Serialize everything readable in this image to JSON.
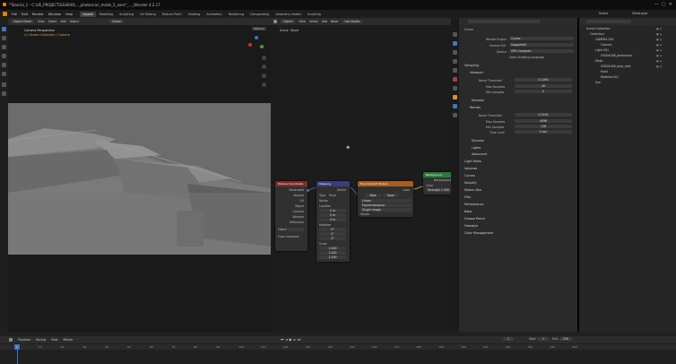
{
  "window": {
    "title": "*Tutorial_1 - C:\\UE_PROJECT\\GS4040\\..._photoscan_mode_5_aero*_..._Blender 4.2.17"
  },
  "menu": {
    "items": [
      "File",
      "Edit",
      "Render",
      "Window",
      "Help"
    ]
  },
  "workspaces": [
    "Layout",
    "Modeling",
    "Sculpting",
    "UV Editing",
    "Texture Paint",
    "Shading",
    "Animation",
    "Rendering",
    "Compositing",
    "Geometry Nodes",
    "Scripting"
  ],
  "active_workspace": "Layout",
  "topright": {
    "scene": "Scene",
    "view_layer": "ViewLayer"
  },
  "viewport": {
    "header": {
      "mode": "Object Mode",
      "view": "View",
      "select": "Select",
      "add": "Add",
      "object": "Object",
      "global": "Global"
    },
    "camera_label": "Camera Perspective",
    "collection_label": "(1) Scene Collection | Camera",
    "options": "Options"
  },
  "node_editor": {
    "header": {
      "type": "Object",
      "view": "View",
      "select": "Select",
      "add": "Add",
      "node": "Node",
      "use_nodes": "Use Nodes"
    },
    "breadcrumb": "Scene",
    "world": "World",
    "nodes": {
      "texcoord": {
        "title": "Texture Coordinate",
        "outputs": [
          "Generated",
          "Normal",
          "UV",
          "Object",
          "Camera",
          "Window",
          "Reflection"
        ],
        "object_label": "Object",
        "from_instancer": "From Instancer"
      },
      "mapping": {
        "title": "Mapping",
        "output": "Vector",
        "type_label": "Type",
        "type_value": "Point",
        "vector": "Vector",
        "location": "Location",
        "rotation": "Rotation",
        "scale": "Scale",
        "loc": [
          "0 m",
          "0 m",
          "0 m"
        ],
        "rot": [
          "0°",
          "0°",
          "0°"
        ],
        "scl": [
          "1.000",
          "1.000",
          "1.000"
        ]
      },
      "envtex": {
        "title": "Environment Texture",
        "output": "Color",
        "new": "New",
        "open": "Open",
        "linear": "Linear",
        "projection": "Equirectangular",
        "single_image": "Single Image",
        "vector": "Vector"
      },
      "background": {
        "title": "Background",
        "output": "Background",
        "color": "Color",
        "strength_label": "Strength",
        "strength": "1.000"
      },
      "world_output": {
        "title": "World Output"
      }
    }
  },
  "properties": {
    "tabs": [
      "Render",
      "Output",
      "View Layer",
      "Scene",
      "World",
      "Collection",
      "Object",
      "Modifiers",
      "Particles",
      "Physics",
      "Constraints",
      "Data",
      "Material"
    ],
    "scene_label": "Scene",
    "render_engine_label": "Render Engine",
    "render_engine": "Cycles",
    "feature_set_label": "Feature Set",
    "feature_set": "Supported",
    "device_label": "Device",
    "device": "GPU Compute",
    "osl": "Open Shading Language",
    "sampling": "Sampling",
    "viewport": "Viewport",
    "noise_threshold": "Noise Threshold",
    "vp_threshold": "0.1000",
    "max_samples": "Max Samples",
    "vp_max": "40",
    "min_samples": "Min Samples",
    "vp_min": "0",
    "denoise": "Denoise",
    "render": "Render",
    "r_threshold": "0.0100",
    "r_max": "4096",
    "r_min": "128",
    "time_limit": "Time Limit",
    "r_time": "0 sec",
    "advanced": "Advanced",
    "lights": "Lights",
    "light_tree": "Light Tree",
    "sections": [
      "Light Paths",
      "Volumes",
      "Curves",
      "Simplify",
      "Motion Blur",
      "Film",
      "Performance",
      "Bake",
      "Grease Pencil",
      "Freestyle",
      "Color Management"
    ]
  },
  "outliner": {
    "header": "Outliner",
    "search_placeholder": "",
    "rows": [
      {
        "name": "Scene Collection",
        "indent": 0
      },
      {
        "name": "Collection",
        "indent": 1
      },
      {
        "name": "CAMERA 001",
        "indent": 2
      },
      {
        "name": "Camera",
        "indent": 3
      },
      {
        "name": "Light 001",
        "indent": 2
      },
      {
        "name": "GS004048_photoscan",
        "indent": 3
      },
      {
        "name": "Mesh",
        "indent": 2
      },
      {
        "name": "GS004048_aero_mat",
        "indent": 3
      },
      {
        "name": "Point",
        "indent": 3
      },
      {
        "name": "Material.001",
        "indent": 3
      },
      {
        "name": "Sun",
        "indent": 2
      }
    ]
  },
  "timeline": {
    "menus": [
      "Playback",
      "Keying",
      "View",
      "Marker"
    ],
    "frame_current": "1",
    "start_label": "Start",
    "start": "1",
    "end_label": "End",
    "end": "250",
    "ticks": [
      "0",
      "10",
      "20",
      "30",
      "40",
      "50",
      "60",
      "70",
      "80",
      "90",
      "100",
      "110",
      "120",
      "130",
      "140",
      "150",
      "160",
      "170",
      "180",
      "190",
      "200",
      "210",
      "220",
      "230",
      "240",
      "250"
    ]
  },
  "colors": {
    "accent": "#3d78c4",
    "texcoord": "#7d2b2b",
    "mapping": "#3c3d7a",
    "texture": "#a85c1f",
    "shader": "#2a7a3a"
  }
}
